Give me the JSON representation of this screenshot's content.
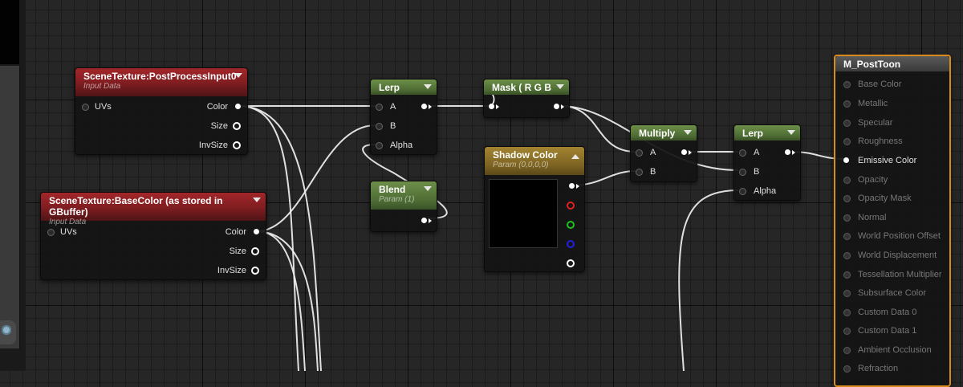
{
  "nodes": {
    "scene_tex_post": {
      "title": "SceneTexture:PostProcessInput0",
      "subtitle": "Input Data",
      "inputs": [
        "UVs"
      ],
      "outputs": [
        "Color",
        "Size",
        "InvSize"
      ]
    },
    "scene_tex_base": {
      "title": "SceneTexture:BaseColor (as stored in GBuffer)",
      "subtitle": "Input Data",
      "inputs": [
        "UVs"
      ],
      "outputs": [
        "Color",
        "Size",
        "InvSize"
      ]
    },
    "lerp1": {
      "title": "Lerp",
      "inputs": [
        "A",
        "B",
        "Alpha"
      ]
    },
    "blend": {
      "title": "Blend",
      "subtitle": "Param (1)"
    },
    "mask": {
      "title": "Mask ( R G B )"
    },
    "shadow_color": {
      "title": "Shadow Color",
      "subtitle": "Param (0,0,0,0)"
    },
    "multiply": {
      "title": "Multiply",
      "inputs": [
        "A",
        "B"
      ]
    },
    "lerp2": {
      "title": "Lerp",
      "inputs": [
        "A",
        "B",
        "Alpha"
      ]
    },
    "output": {
      "title": "M_PostToon",
      "pins": [
        "Base Color",
        "Metallic",
        "Specular",
        "Roughness",
        "Emissive Color",
        "Opacity",
        "Opacity Mask",
        "Normal",
        "World Position Offset",
        "World Displacement",
        "Tessellation Multiplier",
        "Subsurface Color",
        "Custom Data 0",
        "Custom Data 1",
        "Ambient Occlusion",
        "Refraction"
      ]
    }
  },
  "colors": {
    "input_header": "#8c2024",
    "math_header": "#5a7a3c",
    "param_header": "#8a6d28",
    "output_border": "#d98a1e",
    "wire": "#f0f0f0"
  }
}
